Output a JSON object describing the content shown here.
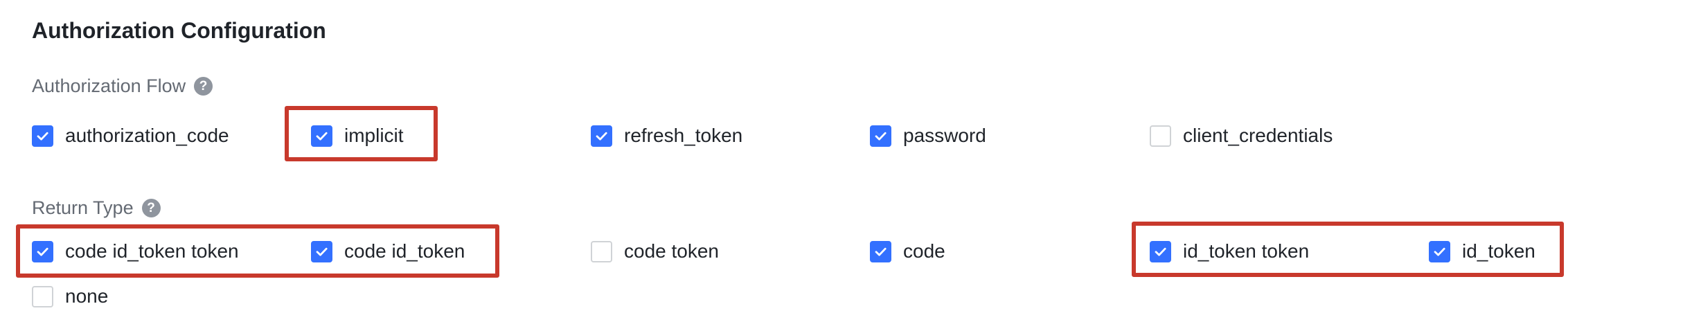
{
  "section_title": "Authorization Configuration",
  "authorization_flow": {
    "label": "Authorization Flow",
    "help_icon": "question-circle-icon",
    "options": [
      {
        "label": "authorization_code",
        "checked": true
      },
      {
        "label": "implicit",
        "checked": true
      },
      {
        "label": "refresh_token",
        "checked": true
      },
      {
        "label": "password",
        "checked": true
      },
      {
        "label": "client_credentials",
        "checked": false
      }
    ]
  },
  "return_type": {
    "label": "Return Type",
    "help_icon": "question-circle-icon",
    "options": [
      {
        "label": "code id_token token",
        "checked": true
      },
      {
        "label": "code id_token",
        "checked": true
      },
      {
        "label": "code token",
        "checked": false
      },
      {
        "label": "code",
        "checked": true
      },
      {
        "label": "id_token token",
        "checked": true
      },
      {
        "label": "id_token",
        "checked": true
      },
      {
        "label": "none",
        "checked": false
      }
    ]
  },
  "help_glyph": "?",
  "colors": {
    "checkbox_checked": "#3370ff",
    "checkbox_border": "#d0d3d6",
    "highlight_box": "#c8392c",
    "label_text": "#646a73",
    "body_text": "#1f2329"
  }
}
